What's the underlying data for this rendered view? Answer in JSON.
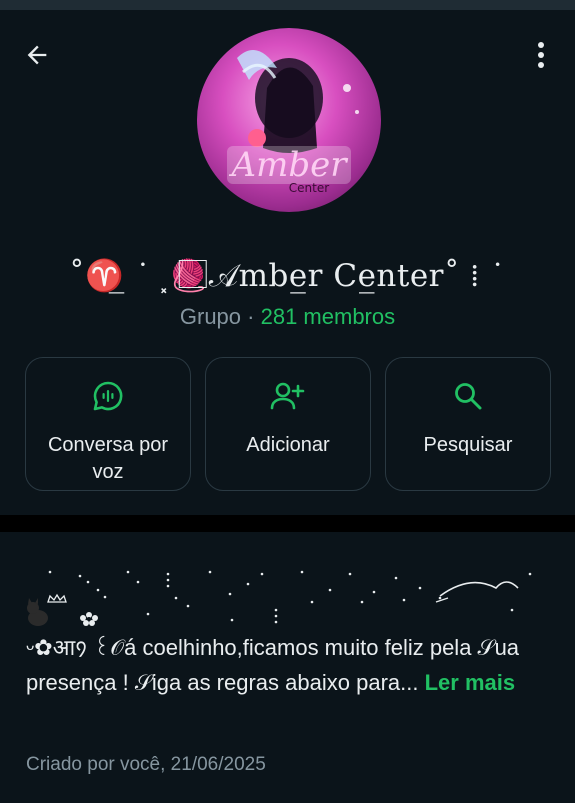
{
  "header": {
    "group_name": "˚♈̲ ˙ ⸼🧶⃞𝒜mbe̲r Ce̲nter˚ ⁞ ˙",
    "type_label": "Grupo",
    "separator": "·",
    "members": "281 membros"
  },
  "actions": [
    {
      "label": "Conversa por voz",
      "icon": "voice-chat-icon"
    },
    {
      "label": "Adicionar",
      "icon": "add-person-icon"
    },
    {
      "label": "Pesquisar",
      "icon": "search-icon"
    }
  ],
  "description": {
    "text": "ᵕ✿आ᠀ ꒰𝒪á coelhinho,ficamos muito feliz pela 𝒮ua presença ! 𝒮iga as regras abaixo para...",
    "read_more": "Ler mais",
    "created": "Criado por você, 21/06/2025"
  },
  "colors": {
    "background": "#0b141a",
    "accent": "#21c063",
    "muted": "#8696a0",
    "card_border": "#2a3942"
  }
}
